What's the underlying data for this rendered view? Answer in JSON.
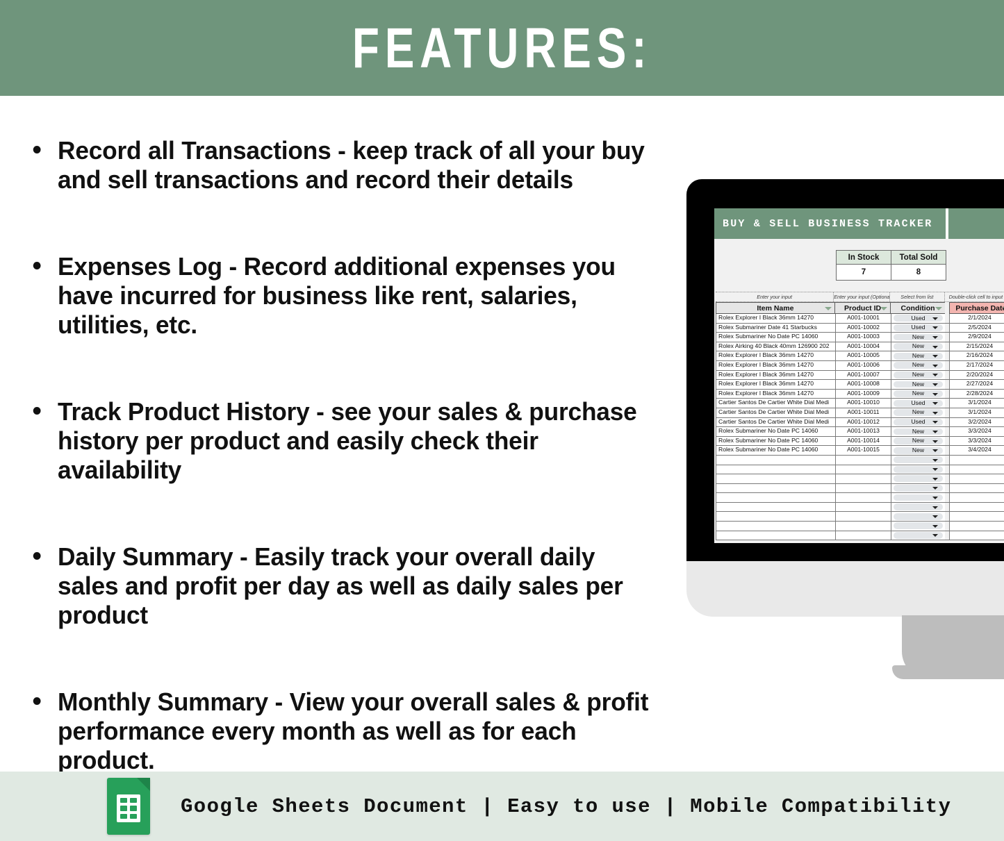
{
  "header": {
    "title": "FEATURES:",
    "background_color": "#6F957C",
    "text_color": "#FFFFFF"
  },
  "features": [
    {
      "text": "Record all Transactions - keep track of all your buy and sell transactions and record their details"
    },
    {
      "text": "Expenses Log - Record additional expenses you have incurred for business like rent, salaries, utilities, etc."
    },
    {
      "text": "Track Product History - see your sales & purchase history per product and easily check their availability"
    },
    {
      "text": "Daily Summary - Easily track your overall daily sales and profit per day as well as daily sales per product"
    },
    {
      "text": "Monthly Summary - View your overall sales & profit performance every month as well as for each product."
    }
  ],
  "spreadsheet": {
    "title": "BUY & SELL BUSINESS TRACKER",
    "title_background_color": "#6F957C",
    "kpis": [
      {
        "label": "In Stock",
        "value": "7"
      },
      {
        "label": "Total Sold",
        "value": "8"
      }
    ],
    "column_hints": [
      "Enter your input",
      "Enter your input (Optional)",
      "Select from list",
      "Double-click cell to input date"
    ],
    "columns": [
      {
        "label": "Item Name",
        "highlight": false
      },
      {
        "label": "Product ID",
        "highlight": false
      },
      {
        "label": "Condition",
        "highlight": false
      },
      {
        "label": "Purchase Date",
        "highlight": true
      }
    ],
    "highlight_color": "#F3B5B0",
    "rows": [
      {
        "item": "Rolex Explorer I Black 36mm 14270",
        "product_id": "A001-10001",
        "condition": "Used",
        "purchase_date": "2/1/2024"
      },
      {
        "item": "Rolex Submariner Date 41 Starbucks",
        "product_id": "A001-10002",
        "condition": "Used",
        "purchase_date": "2/5/2024"
      },
      {
        "item": "Rolex Submariner No Date PC 14060",
        "product_id": "A001-10003",
        "condition": "New",
        "purchase_date": "2/9/2024"
      },
      {
        "item": "Rolex Airking 40 Black 40mm 126900 202",
        "product_id": "A001-10004",
        "condition": "New",
        "purchase_date": "2/15/2024"
      },
      {
        "item": "Rolex Explorer I Black 36mm 14270",
        "product_id": "A001-10005",
        "condition": "New",
        "purchase_date": "2/16/2024"
      },
      {
        "item": "Rolex Explorer I Black 36mm 14270",
        "product_id": "A001-10006",
        "condition": "New",
        "purchase_date": "2/17/2024"
      },
      {
        "item": "Rolex Explorer I Black 36mm 14270",
        "product_id": "A001-10007",
        "condition": "New",
        "purchase_date": "2/20/2024"
      },
      {
        "item": "Rolex Explorer I Black 36mm 14270",
        "product_id": "A001-10008",
        "condition": "New",
        "purchase_date": "2/27/2024"
      },
      {
        "item": "Rolex Explorer I Black 36mm 14270",
        "product_id": "A001-10009",
        "condition": "New",
        "purchase_date": "2/28/2024"
      },
      {
        "item": "Cartier Santos De Cartier White Dial Medi",
        "product_id": "A001-10010",
        "condition": "Used",
        "purchase_date": "3/1/2024"
      },
      {
        "item": "Cartier Santos De Cartier White Dial Medi",
        "product_id": "A001-10011",
        "condition": "New",
        "purchase_date": "3/1/2024"
      },
      {
        "item": "Cartier Santos De Cartier White Dial Medi",
        "product_id": "A001-10012",
        "condition": "Used",
        "purchase_date": "3/2/2024"
      },
      {
        "item": "Rolex Submariner No Date PC 14060",
        "product_id": "A001-10013",
        "condition": "New",
        "purchase_date": "3/3/2024"
      },
      {
        "item": "Rolex Submariner No Date PC 14060",
        "product_id": "A001-10014",
        "condition": "New",
        "purchase_date": "3/3/2024"
      },
      {
        "item": "Rolex Submariner No Date PC 14060",
        "product_id": "A001-10015",
        "condition": "New",
        "purchase_date": "3/4/2024"
      }
    ],
    "empty_row_count": 9
  },
  "footer": {
    "text": "Google Sheets Document | Easy to use | Mobile Compatibility",
    "icon": "google-sheets-icon",
    "background_color": "#E0E9E2"
  }
}
